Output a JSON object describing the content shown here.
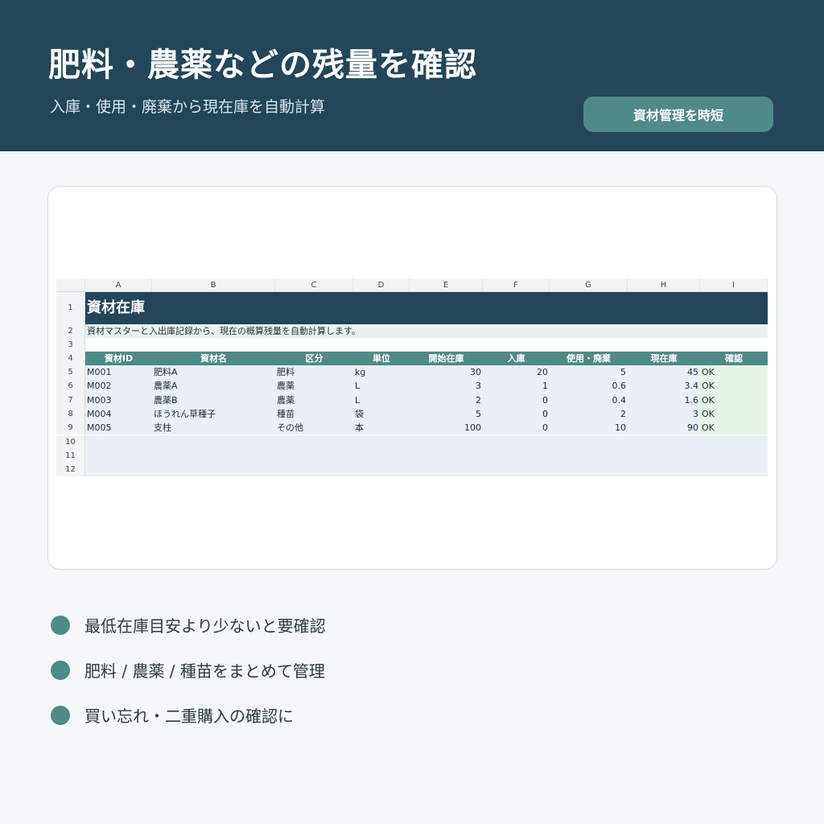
{
  "header": {
    "title": "肥料・農薬などの残量を確認",
    "subtitle": "入庫・使用・廃棄から現在庫を自動計算",
    "badge": "資材管理を時短",
    "bg_color": "#234658",
    "accent_color": "#4e8a87"
  },
  "sheet": {
    "columns": [
      "A",
      "B",
      "C",
      "D",
      "E",
      "F",
      "G",
      "H",
      "I"
    ],
    "row_numbers": [
      "1",
      "2",
      "3",
      "4",
      "5",
      "6",
      "7",
      "8",
      "9",
      "10",
      "11",
      "12"
    ],
    "title": "資材在庫",
    "description": "資材マスターと入出庫記録から、現在の概算残量を自動計算します。",
    "headers": [
      "資材ID",
      "資材名",
      "区分",
      "単位",
      "開始在庫",
      "入庫",
      "使用・廃棄",
      "現在庫",
      "確認"
    ],
    "rows": [
      {
        "id": "M001",
        "name": "肥料A",
        "category": "肥料",
        "unit": "kg",
        "start": "30",
        "in": "20",
        "used": "5",
        "current": "45",
        "check": "OK"
      },
      {
        "id": "M002",
        "name": "農薬A",
        "category": "農薬",
        "unit": "L",
        "start": "3",
        "in": "1",
        "used": "0.6",
        "current": "3.4",
        "check": "OK"
      },
      {
        "id": "M003",
        "name": "農薬B",
        "category": "農薬",
        "unit": "L",
        "start": "2",
        "in": "0",
        "used": "0.4",
        "current": "1.6",
        "check": "OK"
      },
      {
        "id": "M004",
        "name": "ほうれん草種子",
        "category": "種苗",
        "unit": "袋",
        "start": "5",
        "in": "0",
        "used": "2",
        "current": "3",
        "check": "OK"
      },
      {
        "id": "M005",
        "name": "支柱",
        "category": "その他",
        "unit": "本",
        "start": "100",
        "in": "0",
        "used": "10",
        "current": "90",
        "check": "OK"
      }
    ]
  },
  "bullets": [
    "最低在庫目安より少ないと要確認",
    "肥料 / 農薬 / 種苗をまとめて管理",
    "買い忘れ・二重購入の確認に"
  ]
}
